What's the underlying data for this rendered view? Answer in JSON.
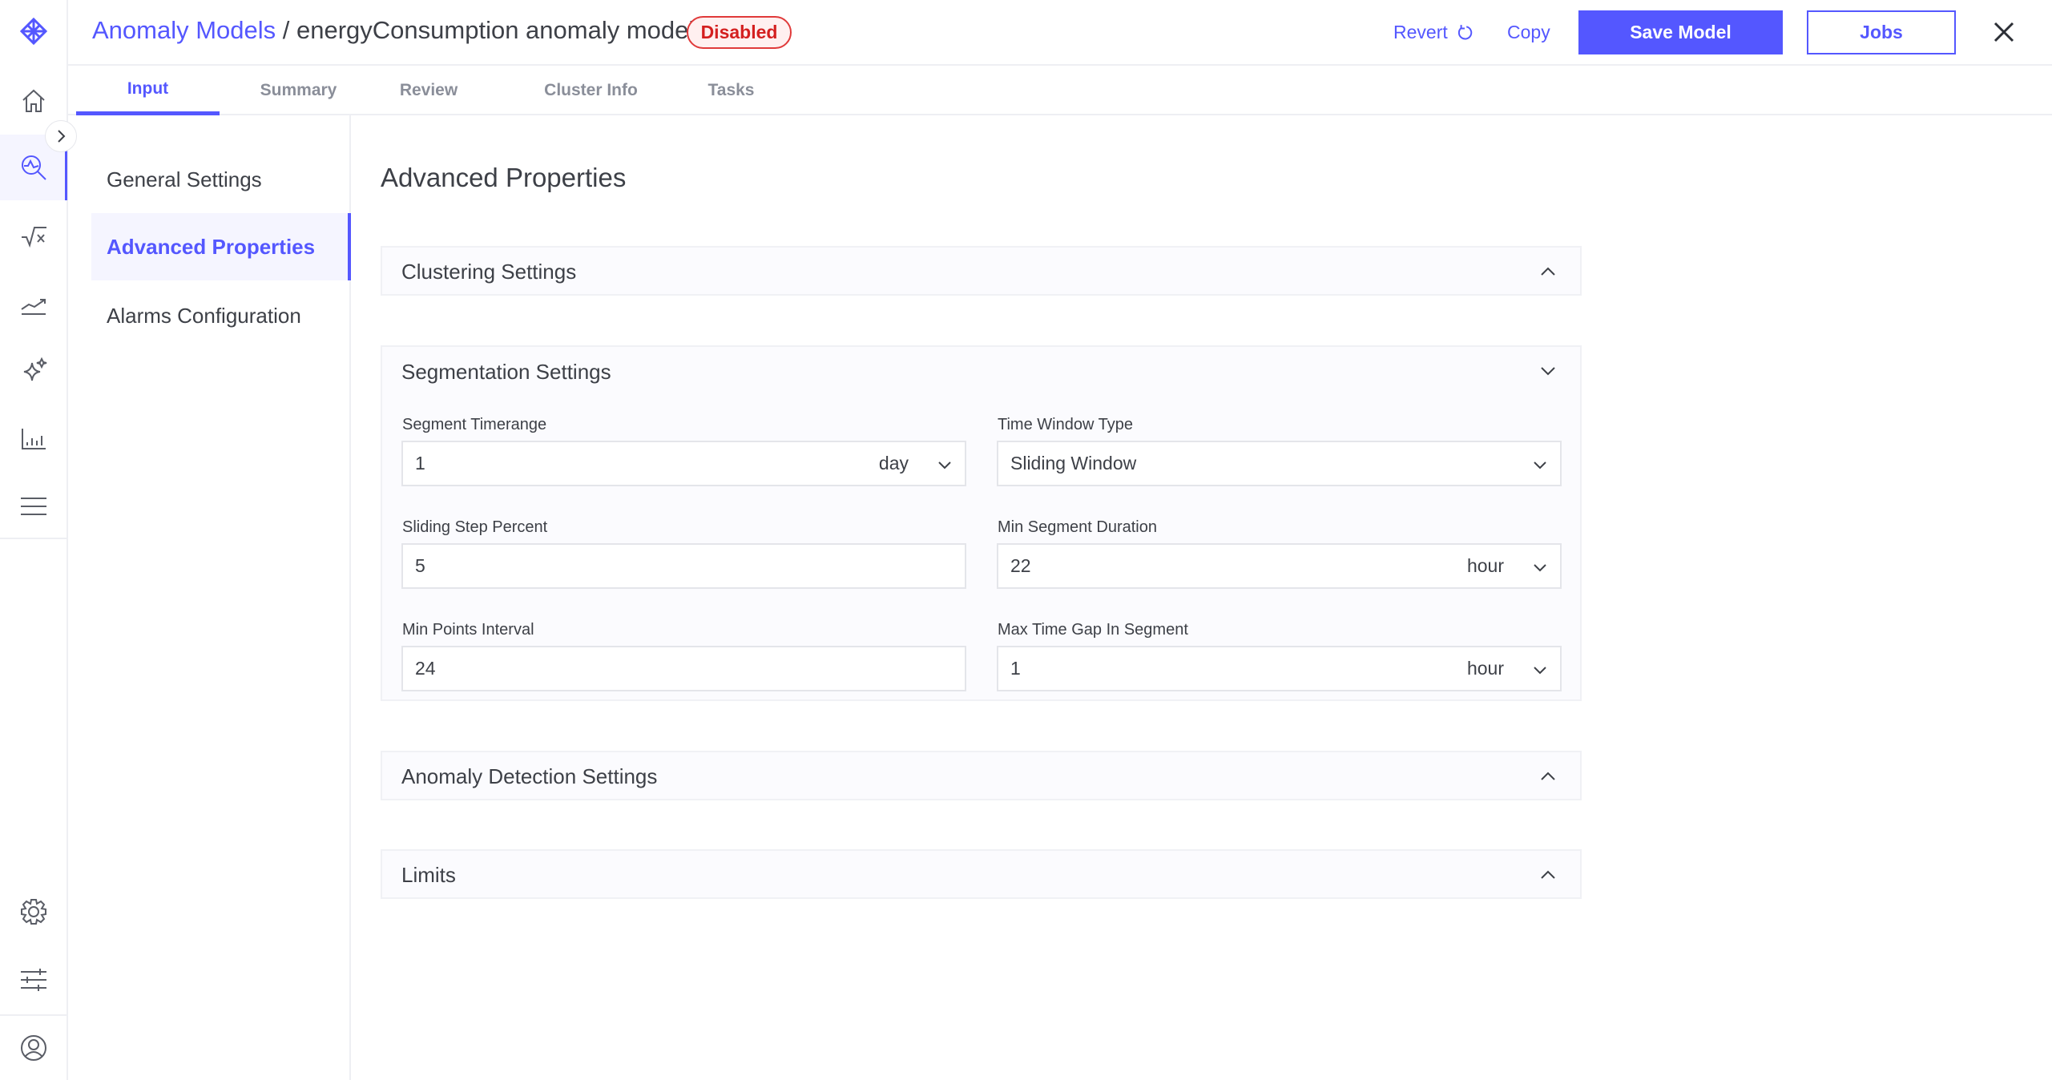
{
  "header": {
    "breadcrumb_root": "Anomaly Models",
    "breadcrumb_separator": " / ",
    "model_name": "energyConsumption anomaly model",
    "status_badge": "Disabled",
    "revert_label": "Revert",
    "copy_label": "Copy",
    "save_label": "Save Model",
    "jobs_label": "Jobs"
  },
  "tabs": [
    {
      "label": "Input",
      "active": true
    },
    {
      "label": "Summary"
    },
    {
      "label": "Review"
    },
    {
      "label": "Cluster Info"
    },
    {
      "label": "Tasks"
    }
  ],
  "subnav": [
    {
      "label": "General Settings"
    },
    {
      "label": "Advanced Properties",
      "active": true
    },
    {
      "label": "Alarms Configuration"
    }
  ],
  "main": {
    "title": "Advanced Properties",
    "panels": {
      "clustering": "Clustering Settings",
      "segmentation": "Segmentation Settings",
      "anomaly": "Anomaly Detection Settings",
      "limits": "Limits"
    },
    "fields": {
      "segment_timerange": {
        "label": "Segment Timerange",
        "value": "1",
        "unit": "day"
      },
      "time_window_type": {
        "label": "Time Window Type",
        "value": "Sliding Window"
      },
      "sliding_step_percent": {
        "label": "Sliding Step Percent",
        "value": "5"
      },
      "min_segment_duration": {
        "label": "Min Segment Duration",
        "value": "22",
        "unit": "hour"
      },
      "min_points_interval": {
        "label": "Min Points Interval",
        "value": "24"
      },
      "max_time_gap": {
        "label": "Max Time Gap In Segment",
        "value": "1",
        "unit": "hour"
      }
    }
  },
  "colors": {
    "accent": "#5457FF",
    "danger": "#D42020",
    "text": "#3D4047"
  }
}
